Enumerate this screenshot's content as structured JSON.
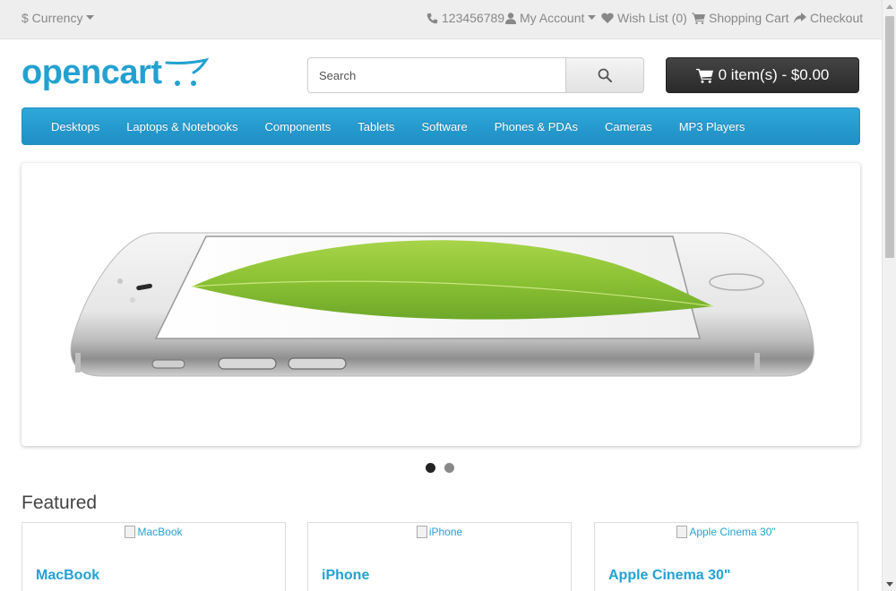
{
  "topbar": {
    "currency_label": "$ Currency",
    "phone": "123456789",
    "my_account": "My Account",
    "wishlist": "Wish List (0)",
    "shopping_cart": "Shopping Cart",
    "checkout": "Checkout"
  },
  "header": {
    "logo_text": "opencart",
    "search_placeholder": "Search",
    "cart_label": "0 item(s) - $0.00"
  },
  "menu": {
    "items": [
      "Desktops",
      "Laptops & Notebooks",
      "Components",
      "Tablets",
      "Software",
      "Phones & PDAs",
      "Cameras",
      "MP3 Players"
    ]
  },
  "slideshow": {
    "slide_count": 2,
    "active_index": 0
  },
  "featured": {
    "title": "Featured",
    "products": [
      {
        "alt": "MacBook",
        "name": "MacBook"
      },
      {
        "alt": "iPhone",
        "name": "iPhone"
      },
      {
        "alt": "Apple Cinema 30\"",
        "name": "Apple Cinema 30\""
      }
    ]
  },
  "colors": {
    "brand": "#23a1d1",
    "menu_bg": "#229ac8",
    "cart_bg": "#363636"
  }
}
